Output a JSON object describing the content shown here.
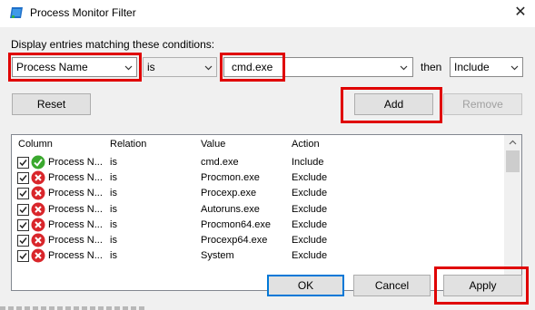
{
  "window": {
    "title": "Process Monitor Filter",
    "close_glyph": "✕"
  },
  "heading": "Display entries matching these conditions:",
  "condition": {
    "column": "Process Name",
    "relation": "is",
    "value": "cmd.exe",
    "then_label": "then",
    "action": "Include"
  },
  "buttons": {
    "reset": "Reset",
    "add": "Add",
    "remove": "Remove",
    "ok": "OK",
    "cancel": "Cancel",
    "apply": "Apply"
  },
  "list": {
    "headers": [
      "Column",
      "Relation",
      "Value",
      "Action"
    ],
    "rows": [
      {
        "checked": true,
        "status": "include",
        "column": "Process N...",
        "relation": "is",
        "value": "cmd.exe",
        "action": "Include"
      },
      {
        "checked": true,
        "status": "exclude",
        "column": "Process N...",
        "relation": "is",
        "value": "Procmon.exe",
        "action": "Exclude"
      },
      {
        "checked": true,
        "status": "exclude",
        "column": "Process N...",
        "relation": "is",
        "value": "Procexp.exe",
        "action": "Exclude"
      },
      {
        "checked": true,
        "status": "exclude",
        "column": "Process N...",
        "relation": "is",
        "value": "Autoruns.exe",
        "action": "Exclude"
      },
      {
        "checked": true,
        "status": "exclude",
        "column": "Process N...",
        "relation": "is",
        "value": "Procmon64.exe",
        "action": "Exclude"
      },
      {
        "checked": true,
        "status": "exclude",
        "column": "Process N...",
        "relation": "is",
        "value": "Procexp64.exe",
        "action": "Exclude"
      },
      {
        "checked": true,
        "status": "exclude",
        "column": "Process N...",
        "relation": "is",
        "value": "System",
        "action": "Exclude"
      }
    ]
  },
  "icons": {
    "app": "process-monitor-icon",
    "include": "green-checkmark-icon",
    "exclude": "red-x-icon"
  },
  "colors": {
    "highlight_box": "#e00000",
    "focus_blue": "#0078d7",
    "include_green": "#3aa82e",
    "exclude_red": "#d9262b"
  }
}
